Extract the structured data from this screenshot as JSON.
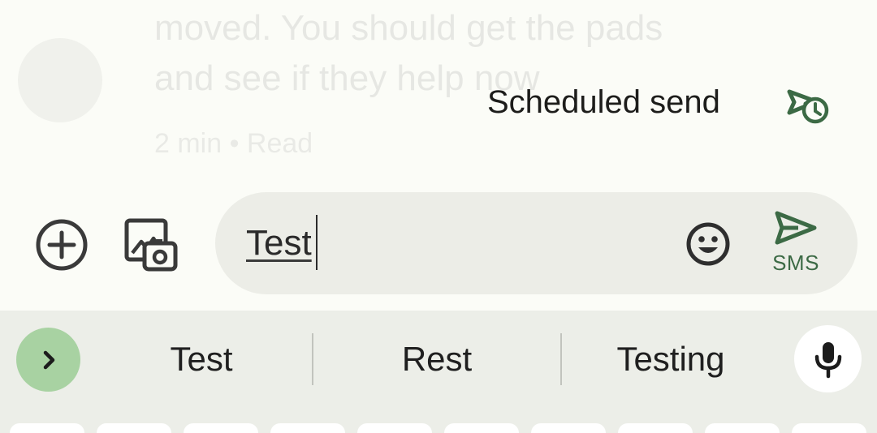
{
  "background_conversation": {
    "lines": [
      "moved. You should get the pads",
      "and see if they help now"
    ],
    "timestamp": "2 min • Read"
  },
  "scheduled_send": {
    "label": "Scheduled send",
    "icon": "scheduled-send-icon"
  },
  "compose": {
    "text": "Test",
    "send_label": "SMS",
    "icons": [
      "add-circle-icon",
      "gallery-camera-icon",
      "emoji-icon",
      "send-icon"
    ]
  },
  "keyboard": {
    "suggestions": [
      "Test",
      "Rest",
      "Testing"
    ],
    "icons": [
      "chevron-right-icon",
      "microphone-icon"
    ]
  },
  "colors": {
    "accent_green": "#3c6a45",
    "expand_button_bg": "#a8d2a2",
    "compose_bg": "#ecede7",
    "strip_bg": "#eceee8"
  }
}
